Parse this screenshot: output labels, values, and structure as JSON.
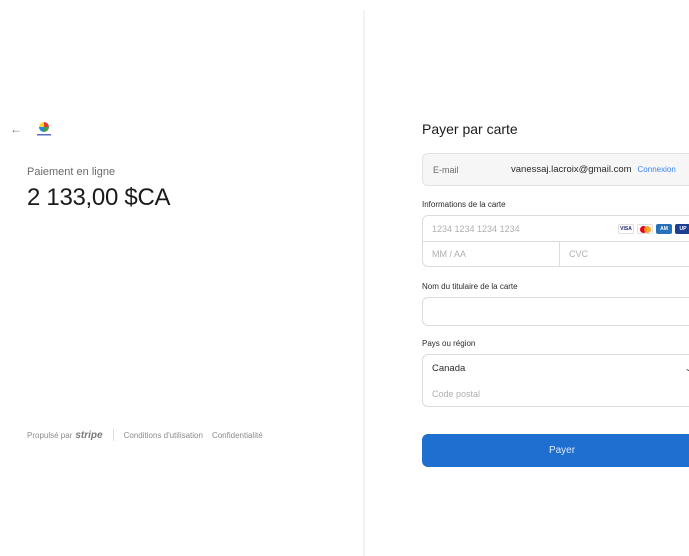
{
  "merchant": {
    "back_icon": "arrow-left-icon",
    "logo_icon": "merchant-logo-icon",
    "subtitle": "Paiement en ligne",
    "amount": "2 133,00 $CA"
  },
  "footer": {
    "powered_prefix": "Propulsé par",
    "powered_brand": "stripe",
    "terms": "Conditions d'utilisation",
    "privacy": "Confidentialité"
  },
  "payment": {
    "title": "Payer par carte",
    "email_label": "E-mail",
    "email_value": "vanessaj.lacroix@gmail.com",
    "email_link": "Connexion",
    "card_info_label": "Informations de la carte",
    "card_number_placeholder": "1234 1234 1234 1234",
    "expiry_placeholder": "MM / AA",
    "cvc_placeholder": "CVC",
    "card_brands": [
      "VISA",
      "Mastercard",
      "American Express",
      "Union"
    ],
    "cardholder_label": "Nom du titulaire de la carte",
    "cardholder_value": "",
    "country_label": "Pays ou région",
    "country_value": "Canada",
    "postal_placeholder": "Code postal",
    "pay_button": "Payer"
  },
  "colors": {
    "accent": "#1f6fd1",
    "link": "#3b82f6"
  }
}
